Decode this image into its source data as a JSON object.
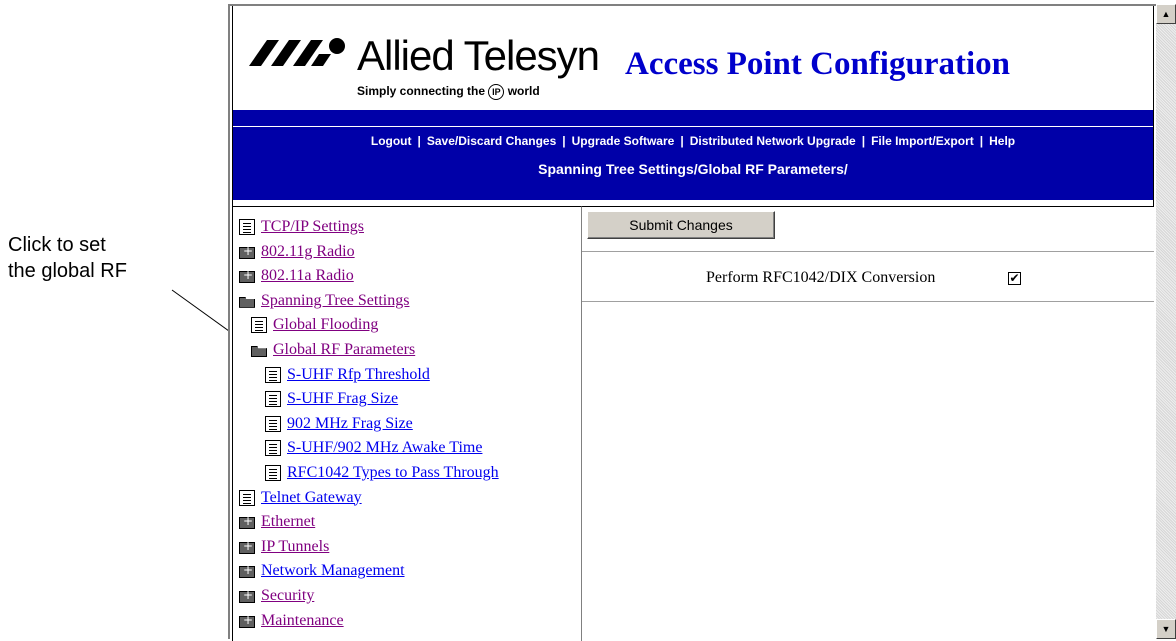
{
  "callout": {
    "line1": "Click to set",
    "line2": "the global RF"
  },
  "brand": {
    "name": "Allied Telesyn",
    "tagline_before": "Simply connecting the",
    "tagline_ip": "IP",
    "tagline_after": "world"
  },
  "app_title": "Access Point Configuration",
  "nav": [
    "Logout",
    "Save/Discard Changes",
    "Upgrade Software",
    "Distributed Network Upgrade",
    "File Import/Export",
    "Help"
  ],
  "breadcrumb": "Spanning Tree Settings/Global RF Parameters/",
  "tree": [
    {
      "label": "TCP/IP Settings",
      "icon": "document-icon",
      "level": 0,
      "state": "visited"
    },
    {
      "label": "802.11g Radio",
      "icon": "folder-closed-icon",
      "level": 0,
      "state": "visited"
    },
    {
      "label": "802.11a Radio",
      "icon": "folder-closed-icon",
      "level": 0,
      "state": "visited"
    },
    {
      "label": "Spanning Tree Settings",
      "icon": "folder-open-icon",
      "level": 0,
      "state": "visited"
    },
    {
      "label": "Global Flooding",
      "icon": "document-icon",
      "level": 1,
      "state": "visited"
    },
    {
      "label": "Global RF Parameters",
      "icon": "folder-open-icon",
      "level": 1,
      "state": "visited"
    },
    {
      "label": "S-UHF Rfp Threshold",
      "icon": "document-icon",
      "level": 2,
      "state": "link"
    },
    {
      "label": "S-UHF Frag Size",
      "icon": "document-icon",
      "level": 2,
      "state": "link"
    },
    {
      "label": "902 MHz Frag Size",
      "icon": "document-icon",
      "level": 2,
      "state": "link"
    },
    {
      "label": "S-UHF/902 MHz Awake Time",
      "icon": "document-icon",
      "level": 2,
      "state": "link"
    },
    {
      "label": "RFC1042 Types to Pass Through",
      "icon": "document-icon",
      "level": 2,
      "state": "link"
    },
    {
      "label": "Telnet Gateway",
      "icon": "document-icon",
      "level": 0,
      "state": "link"
    },
    {
      "label": "Ethernet",
      "icon": "folder-closed-icon",
      "level": 0,
      "state": "visited"
    },
    {
      "label": "IP Tunnels",
      "icon": "folder-closed-icon",
      "level": 0,
      "state": "visited"
    },
    {
      "label": "Network Management",
      "icon": "folder-closed-icon",
      "level": 0,
      "state": "link"
    },
    {
      "label": "Security",
      "icon": "folder-closed-icon",
      "level": 0,
      "state": "visited"
    },
    {
      "label": "Maintenance",
      "icon": "folder-closed-icon",
      "level": 0,
      "state": "visited"
    }
  ],
  "content": {
    "submit_label": "Submit Changes",
    "option_label": "Perform RFC1042/DIX Conversion",
    "option_checked": true
  },
  "colors": {
    "banner": "#0000a8",
    "title": "#0000cc",
    "link": "#0000ee",
    "visited": "#800080"
  }
}
